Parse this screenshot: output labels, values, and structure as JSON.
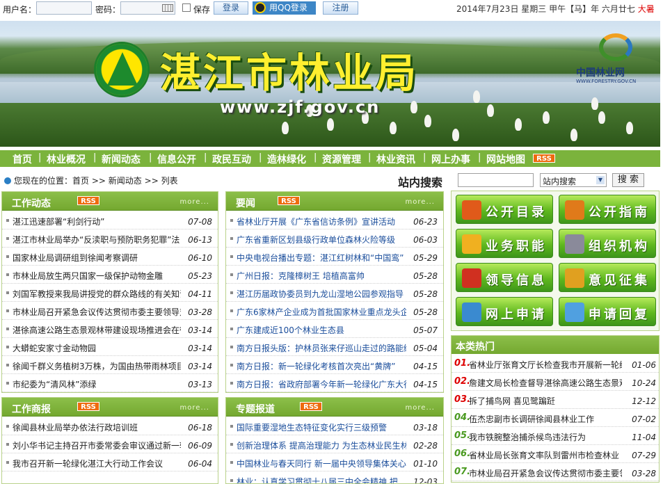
{
  "login": {
    "username_label": "用户名：",
    "password_label": "密码：",
    "remember_label": "保存",
    "login_button": "登录",
    "qq_button": "用QQ登录",
    "register_button": "注册"
  },
  "date": {
    "text": "2014年7月23日  星期三    甲午【马】年 六月廿七",
    "solar_term": "大暑"
  },
  "banner": {
    "site_name": "湛江市林业局",
    "site_url": "www.zjf.gov.cn",
    "partner_name": "中国林业网",
    "partner_url": "WWW.FORESTRY.GOV.CN"
  },
  "nav": [
    "首页",
    "林业概况",
    "新闻动态",
    "信息公开",
    "政民互动",
    "造林绿化",
    "资源管理",
    "林业资讯",
    "网上办事",
    "网站地图"
  ],
  "rss_label": "RSS",
  "more_label": "more...",
  "breadcrumb": {
    "prefix": "您现在的位置：",
    "items": [
      "首页",
      "新闻动态",
      "列表"
    ],
    "sep": ">>"
  },
  "search": {
    "label": "站内搜索",
    "select_value": "站内搜索",
    "button": "搜 索"
  },
  "panels": {
    "work": {
      "title": "工作动态",
      "items": [
        {
          "text": "湛江迅速部署“利剑行动”",
          "date": "07-08"
        },
        {
          "text": "湛江市林业局举办“反渎职与预防职务犯罪”法",
          "date": "06-13"
        },
        {
          "text": "国家林业局调研组到徐闻考察调研",
          "date": "06-10"
        },
        {
          "text": "市林业局放生两只国家一级保护动物金雕",
          "date": "05-23"
        },
        {
          "text": "刘国军教授来我局讲授党的群众路线的有关知识",
          "date": "04-11"
        },
        {
          "text": "市林业局召开紧急会议传达贯彻市委主要领导对",
          "date": "03-28"
        },
        {
          "text": "湛徐高速公路生态景观林带建设现场推进会在徐",
          "date": "03-14"
        },
        {
          "text": "大蟒蛇安家寸金动物园",
          "date": "03-14"
        },
        {
          "text": "徐闻千群义务植树3万株，为国由热带雨林项目添",
          "date": "03-14"
        },
        {
          "text": "市纪委为“清风林”添绿",
          "date": "03-13"
        }
      ]
    },
    "news": {
      "title": "要闻",
      "items": [
        {
          "text": "省林业厅开展《广东省信访条例》宣讲活动",
          "date": "06-23"
        },
        {
          "text": "广东省重新区划县级行政单位森林火险等级",
          "date": "06-03"
        },
        {
          "text": "中央电视台播出专题：湛江红树林和“中国鸾”",
          "date": "05-29"
        },
        {
          "text": "广州日报：克隆樟树王  培植高富帅",
          "date": "05-28"
        },
        {
          "text": "湛江历届政协委员到九龙山湿地公园参观指导",
          "date": "05-28"
        },
        {
          "text": "广东6家林产企业成为首批国家林业重点龙头企业",
          "date": "05-28"
        },
        {
          "text": "广东建成近100个林业生态县",
          "date": "05-07"
        },
        {
          "text": "南方日报头版：护林员张来仔巡山走过的路能绕",
          "date": "05-04"
        },
        {
          "text": "南方日报：新一轮绿化考核首次亮出“黄牌”",
          "date": "04-15"
        },
        {
          "text": "南方日报：省政府部署今年新一轮绿化广东大行",
          "date": "04-15"
        }
      ]
    },
    "notice": {
      "title": "工作商报",
      "items": [
        {
          "text": "徐闻县林业局举办依法行政培训班",
          "date": "06-18"
        },
        {
          "text": "刘小华书记主持召开市委常委会审议通过新一轮",
          "date": "06-09"
        },
        {
          "text": "我市召开新一轮绿化湛江大行动工作会议",
          "date": "06-04"
        }
      ]
    },
    "special": {
      "title": "专题报道",
      "items": [
        {
          "text": "国际重要湿地生态特征变化实行三级预警",
          "date": "03-18"
        },
        {
          "text": "创新治理体系  提高治理能力  为生态林业民生林",
          "date": "02-28"
        },
        {
          "text": "中国林业与春天同行  新一届中央领导集体关心林",
          "date": "01-10"
        },
        {
          "text": "林业：认真学习贯彻十八届三中全会精神  把",
          "date": "12-03"
        }
      ]
    }
  },
  "grid_buttons": [
    {
      "label": "公开目录",
      "icon": "books-icon",
      "color": "#e05a1a"
    },
    {
      "label": "公开指南",
      "icon": "guide-icon",
      "color": "#e07a1a"
    },
    {
      "label": "业务职能",
      "icon": "business-icon",
      "color": "#f0b020"
    },
    {
      "label": "组织机构",
      "icon": "building-icon",
      "color": "#8a8a9a"
    },
    {
      "label": "领导信息",
      "icon": "medal-icon",
      "color": "#d03020"
    },
    {
      "label": "意见征集",
      "icon": "people-icon",
      "color": "#e0a020"
    },
    {
      "label": "网上申请",
      "icon": "form-icon",
      "color": "#3a8ad0"
    },
    {
      "label": "申请回复",
      "icon": "reply-icon",
      "color": "#50a0e0"
    }
  ],
  "hot": {
    "title": "本类热门",
    "items": [
      {
        "n": "01.",
        "text": "省林业厅张育文厅长检查我市开展新一轮绿",
        "date": "01-06",
        "color": "#d00"
      },
      {
        "n": "02.",
        "text": "詹建文局长检查督导湛徐高速公路生态景观",
        "date": "10-24",
        "color": "#d00"
      },
      {
        "n": "03.",
        "text": "拆了捕鸟网  喜见鹭蹁跹",
        "date": "12-12",
        "color": "#d00"
      },
      {
        "n": "04.",
        "text": "伍杰忠副市长调研徐闻县林业工作",
        "date": "07-02",
        "color": "#4a9a20"
      },
      {
        "n": "05.",
        "text": "我市铁腕整治捕杀候鸟违法行为",
        "date": "11-04",
        "color": "#4a9a20"
      },
      {
        "n": "06.",
        "text": "省林业局长张育文率队到雷州市检查林业",
        "date": "07-29",
        "color": "#4a9a20"
      },
      {
        "n": "07.",
        "text": "市林业局召开紧急会议传达贯彻市委主要领",
        "date": "03-28",
        "color": "#4a9a20"
      }
    ]
  }
}
